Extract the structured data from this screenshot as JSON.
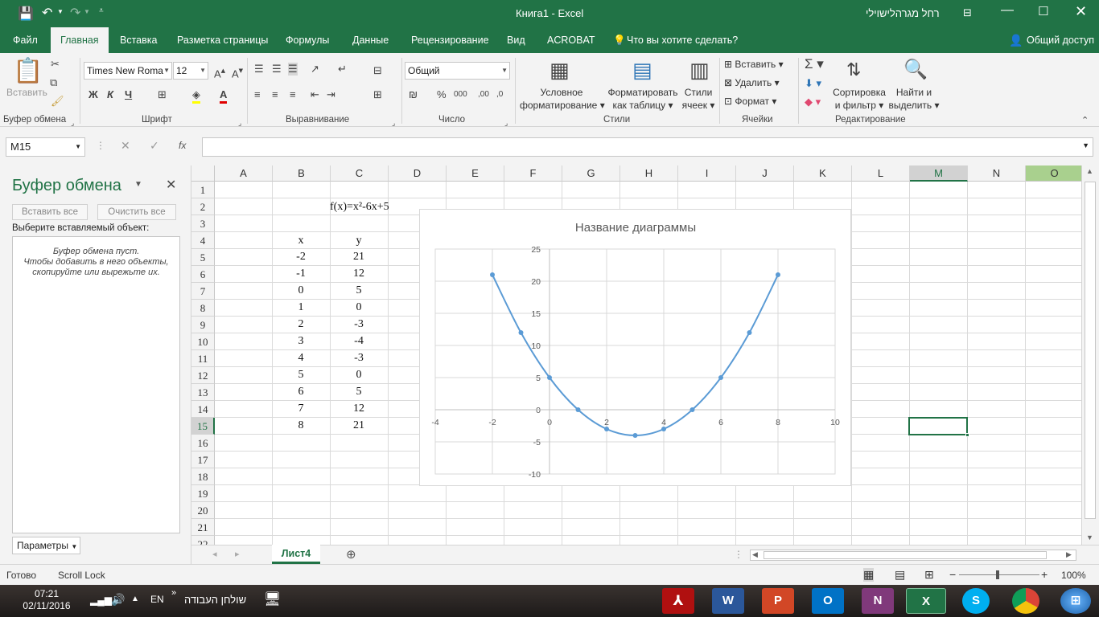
{
  "window": {
    "title": "Книга1  -  Excel",
    "user": "רחל מגרהלישוילי"
  },
  "tabs": [
    {
      "label": "Файл"
    },
    {
      "label": "Главная",
      "active": true
    },
    {
      "label": "Вставка"
    },
    {
      "label": "Разметка страницы"
    },
    {
      "label": "Формулы"
    },
    {
      "label": "Данные"
    },
    {
      "label": "Рецензирование"
    },
    {
      "label": "Вид"
    },
    {
      "label": "ACROBAT"
    }
  ],
  "tellme": "Что вы хотите сделать?",
  "share": "Общий доступ",
  "ribbon": {
    "paste": "Вставить",
    "font_name": "Times New Roma",
    "font_size": "12",
    "bold": "Ж",
    "italic": "К",
    "underline": "Ч",
    "number_format": "Общий",
    "cond_format": [
      "Условное",
      "форматирование"
    ],
    "format_table": [
      "Форматировать",
      "как таблицу"
    ],
    "cell_styles": [
      "Стили",
      "ячеек"
    ],
    "insert": "Вставить",
    "delete": "Удалить",
    "format": "Формат",
    "sort_filter": [
      "Сортировка",
      "и фильтр"
    ],
    "find_select": [
      "Найти и",
      "выделить"
    ],
    "groups": [
      "Буфер обмена",
      "Шрифт",
      "Выравнивание",
      "Число",
      "Стили",
      "Ячейки",
      "Редактирование"
    ]
  },
  "formula": {
    "namebox": "M15",
    "fx": "fx",
    "value": ""
  },
  "clipboard": {
    "title": "Буфер обмена",
    "paste_all": "Вставить все",
    "clear_all": "Очистить все",
    "select_label": "Выберите вставляемый объект:",
    "empty_lines": [
      "Буфер обмена пуст.",
      "Чтобы добавить в него объекты,",
      "скопируйте или вырежьте их."
    ],
    "params": "Параметры"
  },
  "columns": [
    "A",
    "B",
    "C",
    "D",
    "E",
    "F",
    "G",
    "H",
    "I",
    "J",
    "K",
    "L",
    "M",
    "N",
    "O"
  ],
  "rows": [
    "1",
    "2",
    "3",
    "4",
    "5",
    "6",
    "7",
    "8",
    "9",
    "10",
    "11",
    "12",
    "13",
    "14",
    "15",
    "16",
    "17",
    "18",
    "19",
    "20",
    "21",
    "22"
  ],
  "cells": {
    "formula_label": "f(x)=x²-6x+5",
    "x_header": "x",
    "y_header": "y",
    "x": [
      "-2",
      "-1",
      "0",
      "1",
      "2",
      "3",
      "4",
      "5",
      "6",
      "7",
      "8"
    ],
    "y": [
      "21",
      "12",
      "5",
      "0",
      "-3",
      "-4",
      "-3",
      "0",
      "5",
      "12",
      "21"
    ]
  },
  "chart_data": {
    "type": "scatter",
    "title": "Название диаграммы",
    "x": [
      -2,
      -1,
      0,
      1,
      2,
      3,
      4,
      5,
      6,
      7,
      8
    ],
    "y": [
      21,
      12,
      5,
      0,
      -3,
      -4,
      -3,
      0,
      5,
      12,
      21
    ],
    "xlim": [
      -4,
      10
    ],
    "ylim": [
      -10,
      25
    ],
    "xticks": [
      "-4",
      "-2",
      "0",
      "2",
      "4",
      "6",
      "8",
      "10"
    ],
    "yticks": [
      "25",
      "20",
      "15",
      "10",
      "5",
      "0",
      "-5",
      "-10"
    ],
    "grid": true,
    "color": "#5b9bd5"
  },
  "sheet": {
    "tab": "Лист4"
  },
  "status": {
    "ready": "Готово",
    "scroll": "Scroll Lock",
    "zoom": "100%"
  },
  "taskbar": {
    "time": "07:21",
    "date": "02/11/2016",
    "lang": "EN",
    "desktop": "שולחן העבודה"
  },
  "colors": {
    "accent": "#217346",
    "series": "#5b9bd5"
  }
}
